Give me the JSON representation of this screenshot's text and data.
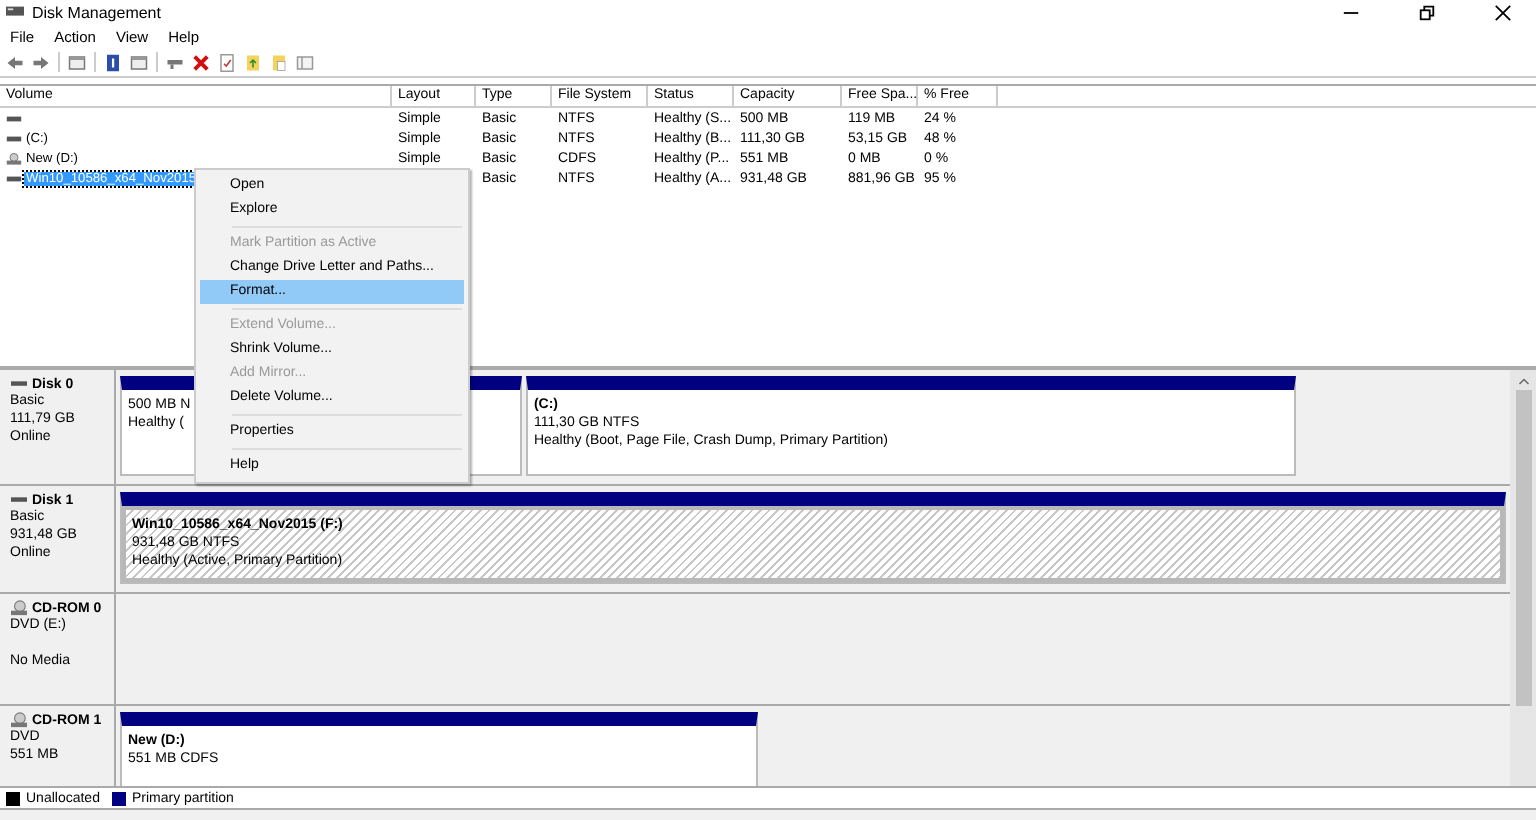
{
  "window": {
    "title": "Disk Management"
  },
  "menu": [
    "File",
    "Action",
    "View",
    "Help"
  ],
  "volumes": {
    "columns": [
      "Volume",
      "Layout",
      "Type",
      "File System",
      "Status",
      "Capacity",
      "Free Spa...",
      "% Free"
    ],
    "rows": [
      {
        "kind": "drive",
        "selected": false,
        "layout": "Simple",
        "type": "Basic",
        "file_system": "NTFS",
        "status": "Healthy (S...",
        "capacity": "500 MB",
        "free_space": "119 MB",
        "percent_free": "24 %"
      },
      {
        "kind": "drive",
        "selected": false,
        "volume": "(C:)",
        "layout": "Simple",
        "type": "Basic",
        "file_system": "NTFS",
        "status": "Healthy (B...",
        "capacity": "111,30 GB",
        "free_space": "53,15 GB",
        "percent_free": "48 %"
      },
      {
        "kind": "cd",
        "selected": false,
        "volume": "New (D:)",
        "layout": "Simple",
        "type": "Basic",
        "file_system": "CDFS",
        "status": "Healthy (P...",
        "capacity": "551 MB",
        "free_space": "0 MB",
        "percent_free": "0 %"
      },
      {
        "kind": "drive",
        "selected": true,
        "volume": "Win10_10586_x64_Nov2015",
        "type": "Basic",
        "file_system": "NTFS",
        "status": "Healthy (A...",
        "capacity": "931,48 GB",
        "free_space": "881,96 GB",
        "percent_free": "95 %"
      }
    ]
  },
  "context_menu": [
    {
      "kind": "item",
      "label": "Open",
      "disabled": false,
      "selected": false
    },
    {
      "kind": "item",
      "label": "Explore",
      "disabled": false,
      "selected": false
    },
    {
      "kind": "separator"
    },
    {
      "kind": "item",
      "label": "Mark Partition as Active",
      "disabled": true,
      "selected": false
    },
    {
      "kind": "item",
      "label": "Change Drive Letter and Paths...",
      "disabled": false,
      "selected": false
    },
    {
      "kind": "item",
      "label": "Format...",
      "disabled": false,
      "selected": true
    },
    {
      "kind": "separator"
    },
    {
      "kind": "item",
      "label": "Extend Volume...",
      "disabled": true,
      "selected": false
    },
    {
      "kind": "item",
      "label": "Shrink Volume...",
      "disabled": false,
      "selected": false
    },
    {
      "kind": "item",
      "label": "Add Mirror...",
      "disabled": true,
      "selected": false
    },
    {
      "kind": "item",
      "label": "Delete Volume...",
      "disabled": false,
      "selected": false
    },
    {
      "kind": "separator"
    },
    {
      "kind": "item",
      "label": "Properties",
      "disabled": false,
      "selected": false
    },
    {
      "kind": "separator"
    },
    {
      "kind": "item",
      "label": "Help",
      "disabled": false,
      "selected": false
    }
  ],
  "disks": [
    {
      "kind": "disk",
      "name": "Disk 0",
      "lines": [
        "Basic",
        "111,79 GB"
      ],
      "status": "Online",
      "partitions": [
        {
          "lines": [
            "500 MB N",
            "Healthy ("
          ],
          "selected": false
        },
        {
          "title": "(C:)",
          "lines": [
            "111,30 GB NTFS",
            "Healthy (Boot, Page File, Crash Dump, Primary Partition)"
          ],
          "selected": false
        }
      ]
    },
    {
      "kind": "disk",
      "name": "Disk 1",
      "lines": [
        "Basic",
        "931,48 GB"
      ],
      "status": "Online",
      "partitions": [
        {
          "title": "Win10_10586_x64_Nov2015  (F:)",
          "lines": [
            "931,48 GB NTFS",
            "Healthy (Active, Primary Partition)"
          ],
          "selected": true
        }
      ]
    },
    {
      "kind": "cdrom",
      "name": "CD-ROM 0",
      "lines": [
        "DVD (E:)"
      ],
      "status": "No Media"
    },
    {
      "kind": "cdrom",
      "name": "CD-ROM 1",
      "lines": [
        "DVD",
        "551 MB"
      ],
      "partitions": [
        {
          "title": "New  (D:)",
          "lines": [
            "551 MB CDFS"
          ],
          "selected": false
        }
      ]
    }
  ],
  "legend": [
    {
      "label": "Unallocated",
      "color": "#000000"
    },
    {
      "label": "Primary partition",
      "color": "#000080"
    }
  ]
}
